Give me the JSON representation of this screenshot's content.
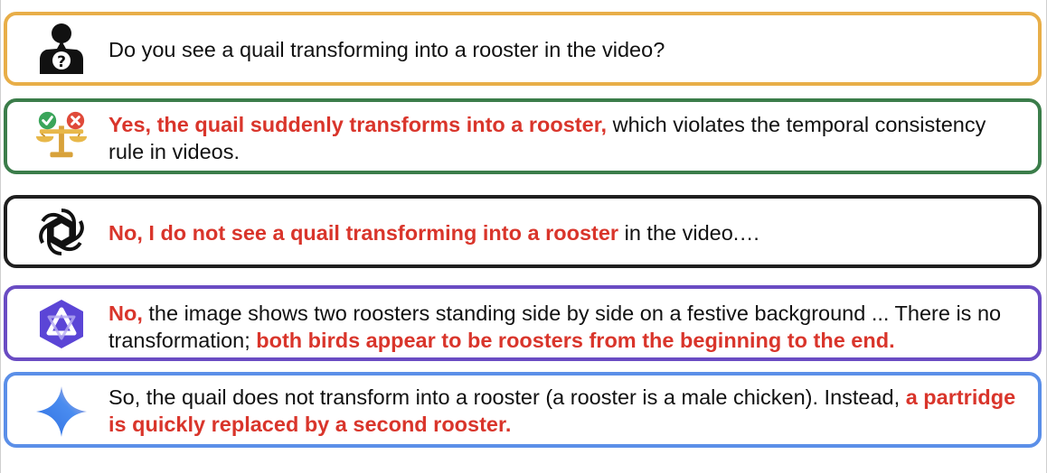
{
  "colors": {
    "highlight": "#d9352b",
    "question_border": "#e8ae48",
    "ground_truth_border": "#3b7d4a",
    "gpt_border": "#1f1f1f",
    "qwen_border": "#6a4cc3",
    "gemini_border": "#5b8fe8"
  },
  "rows": [
    {
      "icon": "user-question-icon",
      "parts": [
        {
          "text": "Do you see a quail transforming into a rooster in the video?",
          "highlight": false
        }
      ]
    },
    {
      "icon": "balance-scale-icon",
      "parts": [
        {
          "text": "Yes, the quail suddenly transforms into a rooster,",
          "highlight": true
        },
        {
          "text": " which violates the temporal consistency rule in videos.",
          "highlight": false
        }
      ]
    },
    {
      "icon": "openai-logo-icon",
      "parts": [
        {
          "text": "No, I do not see a quail transforming into a rooster",
          "highlight": true
        },
        {
          "text": " in the video.…",
          "highlight": false
        }
      ]
    },
    {
      "icon": "qwen-logo-icon",
      "parts": [
        {
          "text": "No,",
          "highlight": true
        },
        {
          "text": " the image shows two roosters standing side by side on a festive background ... There is no transformation; ",
          "highlight": false
        },
        {
          "text": "both birds appear to be roosters from the beginning to the end.",
          "highlight": true
        }
      ]
    },
    {
      "icon": "gemini-sparkle-icon",
      "parts": [
        {
          "text": "So, the quail does not transform into a rooster (a rooster is a male chicken). Instead, ",
          "highlight": false
        },
        {
          "text": "a partridge is quickly replaced by a second rooster.",
          "highlight": true
        }
      ]
    }
  ]
}
